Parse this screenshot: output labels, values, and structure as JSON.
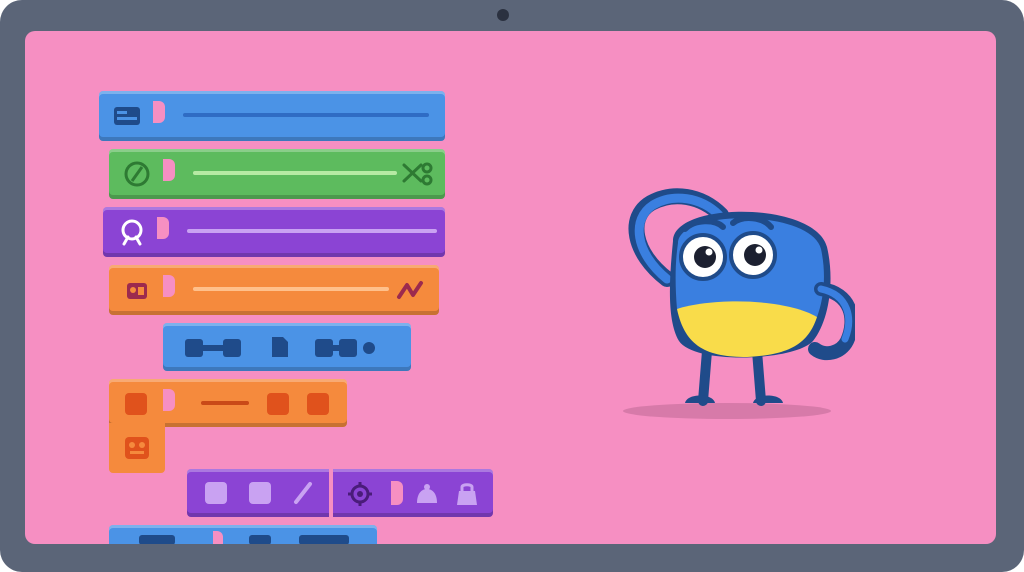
{
  "screen": {
    "background": "#f68fc2"
  },
  "palette": {
    "blue": "#4b93e6",
    "green": "#5dbb5e",
    "purple": "#8b44d4",
    "orange": "#f58a3d",
    "navy": "#1f4b8a"
  },
  "blocks": [
    {
      "id": "motion",
      "color": "blue",
      "icons": [
        "window-icon"
      ]
    },
    {
      "id": "looks",
      "color": "green",
      "icons": [
        "leaf-icon",
        "scissors-icon"
      ]
    },
    {
      "id": "sound",
      "color": "purple",
      "icons": [
        "face-icon"
      ]
    },
    {
      "id": "events",
      "color": "orange",
      "icons": [
        "figure-icon",
        "flag-icon"
      ]
    },
    {
      "id": "sensing",
      "color": "blue",
      "icons": [
        "connector-icon",
        "page-icon",
        "connector-icon"
      ]
    },
    {
      "id": "control-loop",
      "color": "orange",
      "icons": [
        "square-icon",
        "square-icon",
        "square-icon",
        "robot-face-icon"
      ]
    },
    {
      "id": "operators",
      "color": "purple",
      "icons": [
        "square-icon",
        "square-icon",
        "pencil-icon",
        "target-icon",
        "bell-icon",
        "bag-icon"
      ]
    }
  ],
  "mascot": {
    "body_top": "#3a7fe0",
    "belly": "#f9dc4a",
    "outline": "#1f4b8a",
    "mood": "confused"
  }
}
